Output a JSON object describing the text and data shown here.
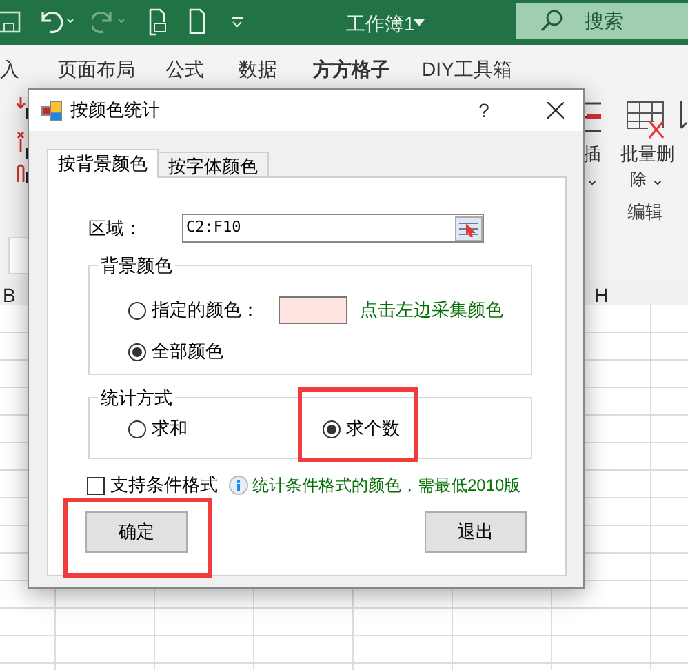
{
  "title_bar": {
    "title": "工作簿1",
    "search_placeholder": "搜索"
  },
  "ribbon_tabs": [
    {
      "label": "入",
      "selected": false
    },
    {
      "label": "页面布局",
      "selected": false
    },
    {
      "label": "公式",
      "selected": false
    },
    {
      "label": "数据",
      "selected": false
    },
    {
      "label": "方方格子",
      "selected": true
    },
    {
      "label": "DIY工具箱",
      "selected": false
    }
  ],
  "ribbon_buttons": [
    {
      "line1": "插",
      "line2": "⌄"
    },
    {
      "line1": "批量删",
      "line2": "除 ⌄"
    }
  ],
  "ribbon_group": "编辑",
  "columns": [
    "B",
    "H"
  ],
  "dialog": {
    "title": "按颜色统计",
    "help": "?",
    "tabs": [
      {
        "label": "按背景颜色",
        "selected": true
      },
      {
        "label": "按字体颜色",
        "selected": false
      }
    ],
    "range_label": "区域：",
    "range_value": "C2:F10",
    "bg_group": {
      "title": "背景颜色",
      "options": [
        {
          "label": "指定的颜色：",
          "selected": false
        },
        {
          "label": "全部颜色",
          "selected": true
        }
      ],
      "hint": "点击左边采集颜色"
    },
    "stat_group": {
      "title": "统计方式",
      "options": [
        {
          "label": "求和",
          "selected": false
        },
        {
          "label": "求个数",
          "selected": true
        }
      ]
    },
    "conditional": {
      "label": "支持条件格式",
      "checked": false,
      "note": "统计条件格式的颜色，需最低2010版"
    },
    "buttons": [
      "确定",
      "退出"
    ]
  }
}
